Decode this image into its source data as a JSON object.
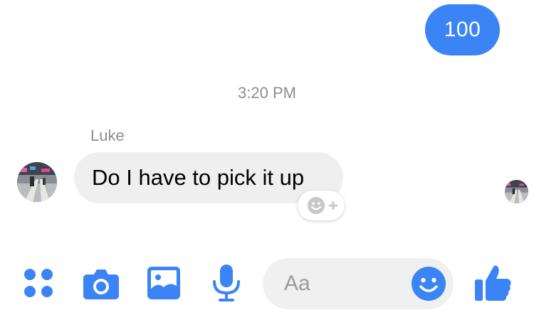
{
  "colors": {
    "accent": "#3b84f5",
    "incoming_bubble": "#efefef",
    "meta_text": "#8e8e93"
  },
  "messages": {
    "outgoing": {
      "text": "100"
    },
    "timestamp": "3:20 PM",
    "incoming": {
      "sender": "Luke",
      "text": "Do I have to pick it up"
    }
  },
  "react": {
    "icon": "smiley-plus-icon"
  },
  "read_receipt": {
    "icon": "avatar"
  },
  "composer": {
    "input_value": "",
    "placeholder": "Aa",
    "icons": [
      "more-dots-icon",
      "camera-icon",
      "photo-icon",
      "microphone-icon",
      "emoji-icon",
      "thumbs-up-icon"
    ]
  }
}
